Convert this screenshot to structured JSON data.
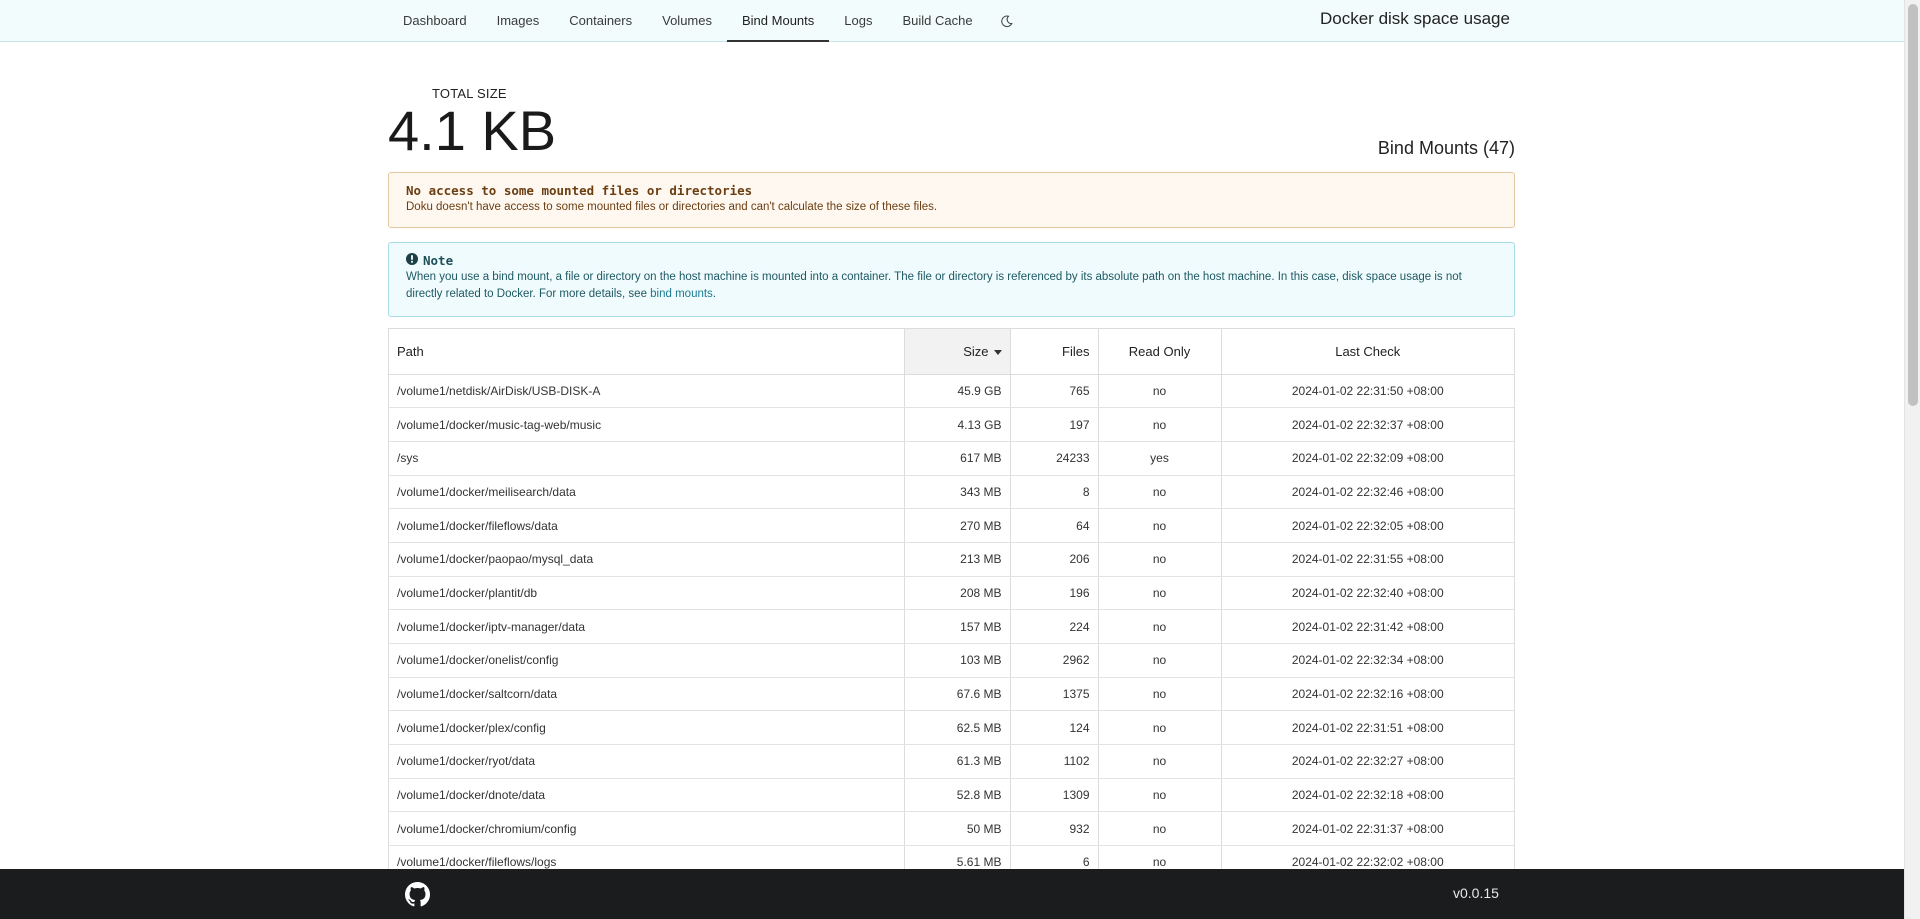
{
  "nav": {
    "items": [
      {
        "label": "Dashboard",
        "active": false
      },
      {
        "label": "Images",
        "active": false
      },
      {
        "label": "Containers",
        "active": false
      },
      {
        "label": "Volumes",
        "active": false
      },
      {
        "label": "Bind Mounts",
        "active": true
      },
      {
        "label": "Logs",
        "active": false
      },
      {
        "label": "Build Cache",
        "active": false
      }
    ],
    "theme_toggle_icon": "moon-icon",
    "app_title": "Docker disk space usage"
  },
  "summary": {
    "total_label": "TOTAL SIZE",
    "total_value": "4.1 KB",
    "section_title": "Bind Mounts (47)"
  },
  "warning": {
    "heading": "No access to some mounted files or directories",
    "text": "Doku doesn't have access to some mounted files or directories and can't calculate the size of these files."
  },
  "note": {
    "icon": "info-circle-icon",
    "heading": "Note",
    "text_before_link": "When you use a bind mount, a file or directory on the host machine is mounted into a container. The file or directory is referenced by its absolute path on the host machine. In this case, disk space usage is not directly related to Docker. For more details, see ",
    "link_text": "bind mounts",
    "text_after_link": "."
  },
  "table": {
    "headers": {
      "path": "Path",
      "size": "Size",
      "files": "Files",
      "read_only": "Read Only",
      "last_check": "Last Check"
    },
    "sorted_by": "Size",
    "rows": [
      {
        "path": "/volume1/netdisk/AirDisk/USB-DISK-A",
        "size": "45.9 GB",
        "files": "765",
        "read_only": "no",
        "last_check": "2024-01-02  22:31:50 +08:00"
      },
      {
        "path": "/volume1/docker/music-tag-web/music",
        "size": "4.13 GB",
        "files": "197",
        "read_only": "no",
        "last_check": "2024-01-02  22:32:37 +08:00"
      },
      {
        "path": "/sys",
        "size": "617 MB",
        "files": "24233",
        "read_only": "yes",
        "last_check": "2024-01-02  22:32:09 +08:00"
      },
      {
        "path": "/volume1/docker/meilisearch/data",
        "size": "343 MB",
        "files": "8",
        "read_only": "no",
        "last_check": "2024-01-02  22:32:46 +08:00"
      },
      {
        "path": "/volume1/docker/fileflows/data",
        "size": "270 MB",
        "files": "64",
        "read_only": "no",
        "last_check": "2024-01-02  22:32:05 +08:00"
      },
      {
        "path": "/volume1/docker/paopao/mysql_data",
        "size": "213 MB",
        "files": "206",
        "read_only": "no",
        "last_check": "2024-01-02  22:31:55 +08:00"
      },
      {
        "path": "/volume1/docker/plantit/db",
        "size": "208 MB",
        "files": "196",
        "read_only": "no",
        "last_check": "2024-01-02  22:32:40 +08:00"
      },
      {
        "path": "/volume1/docker/iptv-manager/data",
        "size": "157 MB",
        "files": "224",
        "read_only": "no",
        "last_check": "2024-01-02  22:31:42 +08:00"
      },
      {
        "path": "/volume1/docker/onelist/config",
        "size": "103 MB",
        "files": "2962",
        "read_only": "no",
        "last_check": "2024-01-02  22:32:34 +08:00"
      },
      {
        "path": "/volume1/docker/saltcorn/data",
        "size": "67.6 MB",
        "files": "1375",
        "read_only": "no",
        "last_check": "2024-01-02  22:32:16 +08:00"
      },
      {
        "path": "/volume1/docker/plex/config",
        "size": "62.5 MB",
        "files": "124",
        "read_only": "no",
        "last_check": "2024-01-02  22:31:51 +08:00"
      },
      {
        "path": "/volume1/docker/ryot/data",
        "size": "61.3 MB",
        "files": "1102",
        "read_only": "no",
        "last_check": "2024-01-02  22:32:27 +08:00"
      },
      {
        "path": "/volume1/docker/dnote/data",
        "size": "52.8 MB",
        "files": "1309",
        "read_only": "no",
        "last_check": "2024-01-02  22:32:18 +08:00"
      },
      {
        "path": "/volume1/docker/chromium/config",
        "size": "50 MB",
        "files": "932",
        "read_only": "no",
        "last_check": "2024-01-02  22:31:37 +08:00"
      },
      {
        "path": "/volume1/docker/fileflows/logs",
        "size": "5.61 MB",
        "files": "6",
        "read_only": "no",
        "last_check": "2024-01-02  22:32:02 +08:00"
      }
    ]
  },
  "footer": {
    "github_icon": "github-icon",
    "version": "v0.0.15"
  }
}
